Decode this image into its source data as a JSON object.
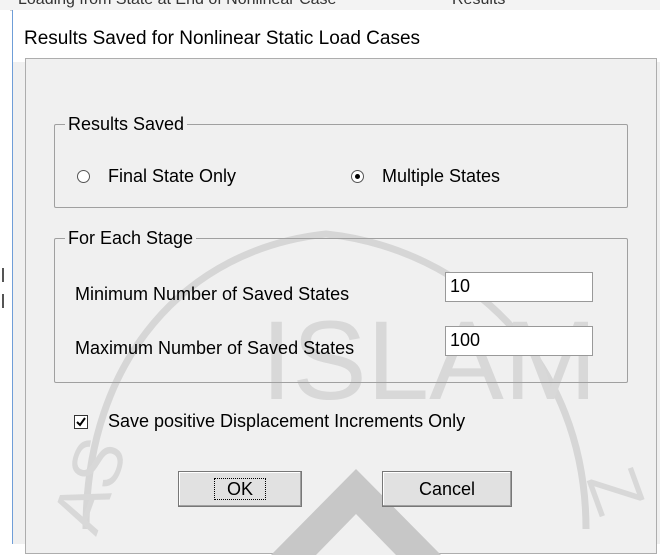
{
  "background": {
    "top_text_left": "Loading from State at End of Nonlinear Case",
    "top_text_right": "Results"
  },
  "dialog": {
    "title": "Results Saved for Nonlinear Static Load Cases"
  },
  "results_saved": {
    "legend": "Results Saved",
    "options": [
      {
        "label": "Final State Only",
        "selected": false
      },
      {
        "label": "Multiple States",
        "selected": true
      }
    ]
  },
  "for_each_stage": {
    "legend": "For Each Stage",
    "min_label": "Minimum Number of Saved States",
    "min_value": "10",
    "max_label": "Maximum Number of Saved States",
    "max_value": "100"
  },
  "options": {
    "positive_only_label": "Save positive Displacement Increments Only",
    "positive_only_checked": true
  },
  "buttons": {
    "ok": "OK",
    "cancel": "Cancel"
  },
  "watermark": {
    "text": "ISLAM"
  }
}
